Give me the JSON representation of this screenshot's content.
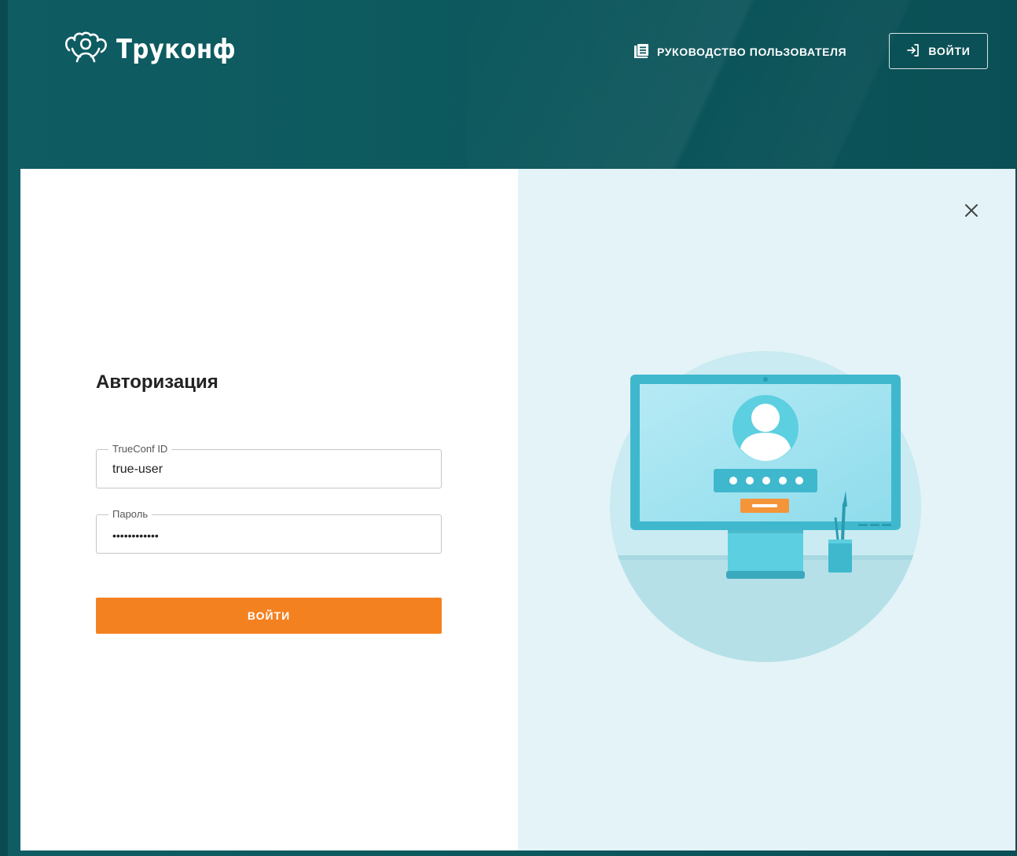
{
  "header": {
    "brand": "Труконф",
    "guide_label": "РУКОВОДСТВО ПОЛЬЗОВАТЕЛЯ",
    "login_label": "ВОЙТИ"
  },
  "auth": {
    "title": "Авторизация",
    "id_field": {
      "label": "TrueConf ID",
      "value": "true-user"
    },
    "password_field": {
      "label": "Пароль",
      "value": "••••••••••••"
    },
    "submit_label": "ВОЙТИ"
  },
  "icons": {
    "logo": "people-group-icon",
    "guide": "manual-book-icon",
    "login": "login-arrow-icon",
    "close": "close-icon"
  },
  "colors": {
    "header_bg": "#0c585d",
    "accent": "#f48120",
    "illustration_bg": "#e3f3f7"
  }
}
